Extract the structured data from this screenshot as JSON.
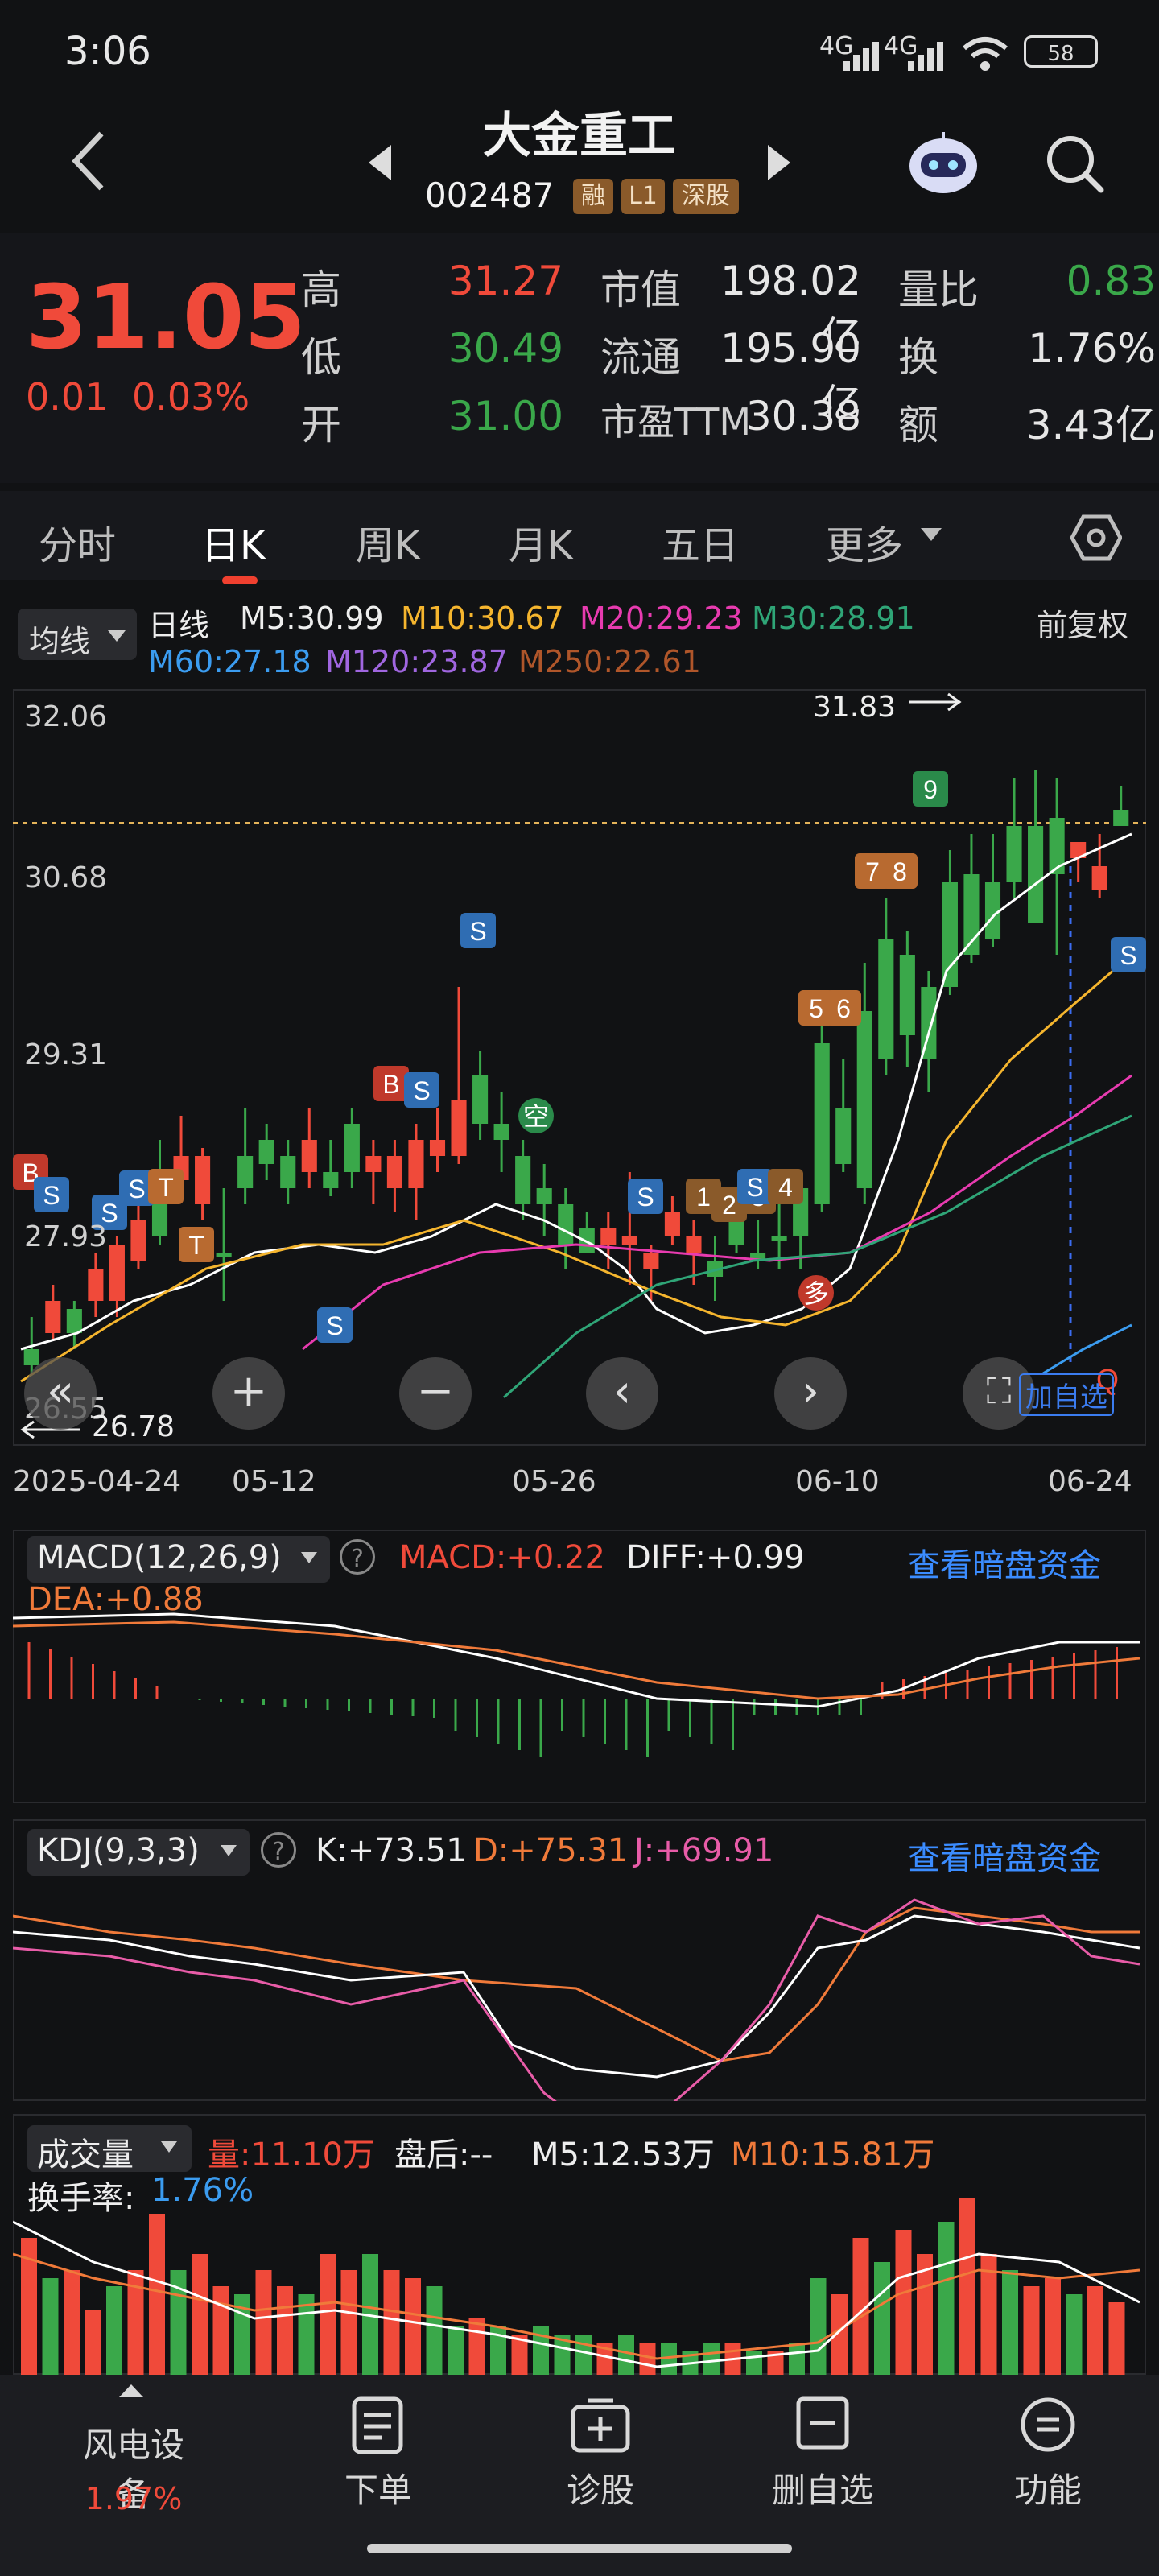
{
  "status": {
    "time": "3:06",
    "net1": "4G",
    "net2": "4G",
    "battery": "58"
  },
  "header": {
    "name": "大金重工",
    "code": "002487",
    "tags": [
      "融",
      "L1",
      "深股"
    ]
  },
  "quote": {
    "price": "31.05",
    "change": "0.01",
    "change_pct": "0.03%",
    "rows": [
      {
        "l1": "高",
        "v1": "31.27",
        "l2": "市值",
        "v2": "198.02亿",
        "l3": "量比",
        "v3": "0.83"
      },
      {
        "l1": "低",
        "v1": "30.49",
        "l2": "流通",
        "v2": "195.90亿",
        "l3": "换",
        "v3": "1.76%"
      },
      {
        "l1": "开",
        "v1": "31.00",
        "l2": "市盈TTM",
        "v2": "30.38",
        "l3": "额",
        "v3": "3.43亿"
      }
    ]
  },
  "tabs": [
    "分时",
    "日K",
    "周K",
    "月K",
    "五日",
    "更多"
  ],
  "ma_legend": {
    "select": "均线",
    "period": "日线",
    "m5": "M5:30.99",
    "m10": "M10:30.67",
    "m20": "M20:29.23",
    "m30": "M30:28.91",
    "m60": "M60:27.18",
    "m120": "M120:23.87",
    "m250": "M250:22.61",
    "adjust": "前复权"
  },
  "kline": {
    "y_labels": [
      "32.06",
      "30.68",
      "29.31",
      "27.93",
      "26.55"
    ],
    "high_mark": "31.83",
    "low_mark": "26.78",
    "dates": [
      "2025-04-24",
      "05-12",
      "05-26",
      "06-10",
      "06-24"
    ],
    "add_watch": "加自选",
    "badges": {
      "S": "S",
      "B": "B",
      "T": "T",
      "kong": "空",
      "duo": "多",
      "q": "Q"
    },
    "nums": [
      "1",
      "2",
      "3",
      "4",
      "5",
      "6",
      "7",
      "8",
      "9"
    ]
  },
  "chart_data": {
    "type": "candlestick",
    "dates_shown": [
      "2025-04-24",
      "05-12",
      "05-26",
      "06-10",
      "06-24"
    ],
    "ylim": [
      26.55,
      32.06
    ],
    "high": 31.83,
    "low": 26.78,
    "last_close": 31.05
  },
  "macd": {
    "select": "MACD(12,26,9)",
    "macd": "MACD:+0.22",
    "diff": "DIFF:+0.99",
    "dea": "DEA:+0.88",
    "link": "查看暗盘资金"
  },
  "kdj": {
    "select": "KDJ(9,3,3)",
    "k": "K:+73.51",
    "d": "D:+75.31",
    "j": "J:+69.91",
    "link": "查看暗盘资金"
  },
  "vol": {
    "select": "成交量",
    "vol": "量:11.10万",
    "after": "盘后:-- ",
    "m5": "M5:12.53万",
    "m10": "M10:15.81万",
    "turnover_label": "换手率:",
    "turnover": "1.76%"
  },
  "nav": {
    "sector": "风电设备",
    "sector_pct": "1.97%",
    "order": "下单",
    "diagnose": "诊股",
    "remove": "删自选",
    "func": "功能"
  },
  "colors": {
    "up": "#f04a3a",
    "down": "#3aa84a",
    "accent": "#3b8cff"
  }
}
